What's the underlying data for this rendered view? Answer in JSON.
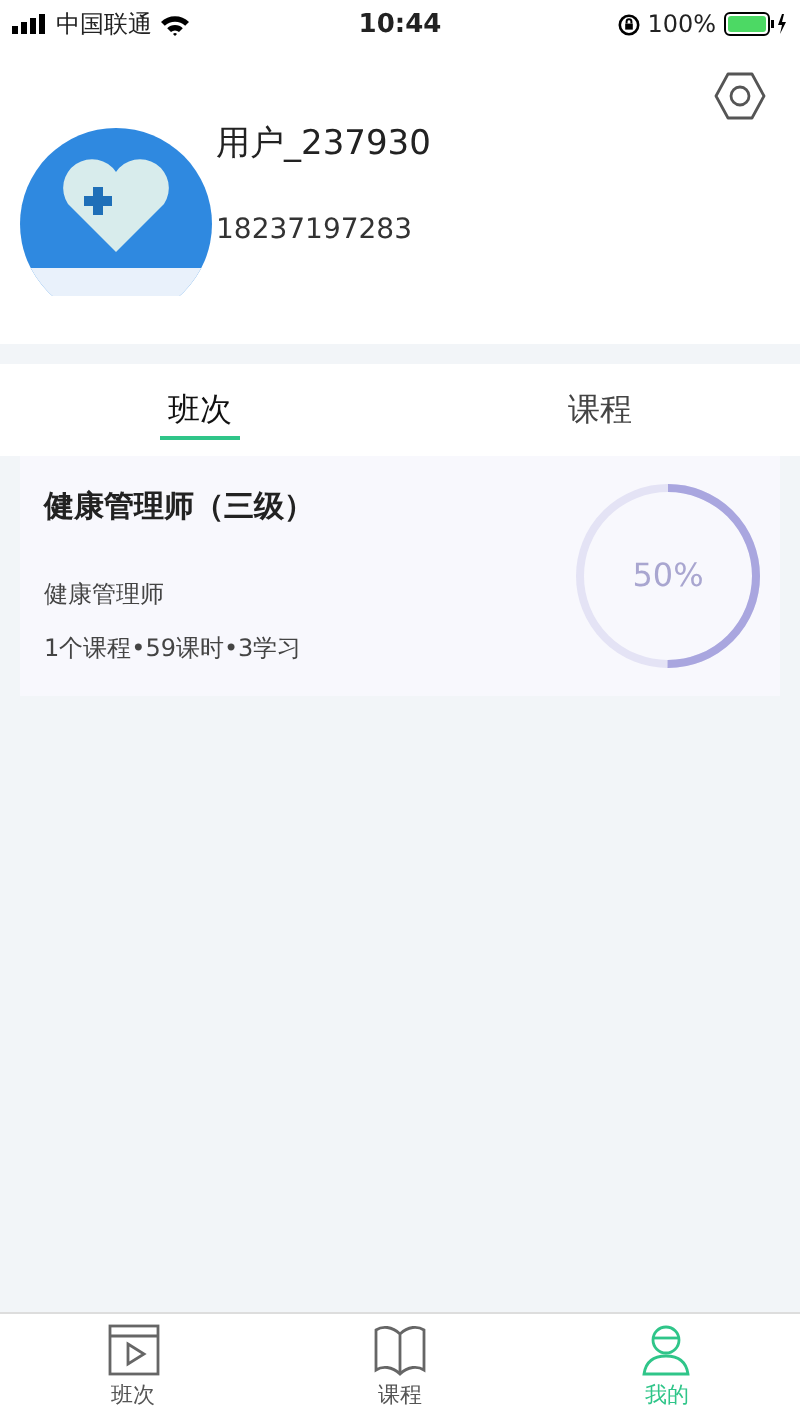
{
  "status_bar": {
    "carrier": "中国联通",
    "time": "10:44",
    "battery": "100%"
  },
  "profile": {
    "username": "用户_237930",
    "phone": "18237197283"
  },
  "tabs": [
    {
      "label": "班次",
      "selected": true
    },
    {
      "label": "课程",
      "selected": false
    }
  ],
  "classes": [
    {
      "title": "健康管理师（三级）",
      "subtitle": "健康管理师",
      "meta": "1个课程•59课时•3学习",
      "level": 0.5,
      "progress": "50%"
    }
  ],
  "tab_bar": [
    {
      "label": "班次",
      "kind": "video",
      "selected": false
    },
    {
      "label": "课程",
      "kind": "book",
      "selected": false
    },
    {
      "label": "我的",
      "kind": "person",
      "selected": true
    }
  ]
}
